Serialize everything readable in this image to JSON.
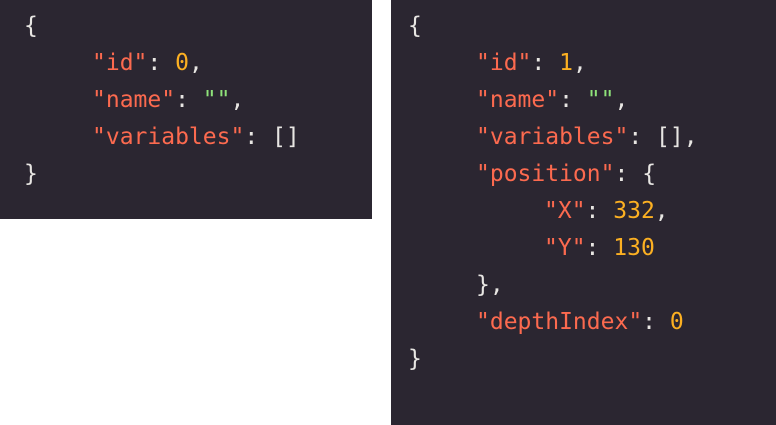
{
  "colors": {
    "background": "#2b2631",
    "key": "#fc6a4f",
    "number": "#fcb022",
    "string": "#8fe37a",
    "punctuation": "#e8e6e3"
  },
  "left": {
    "open_brace": "{",
    "id_key": "\"id\"",
    "id_value": "0",
    "name_key": "\"name\"",
    "name_value": "\"\"",
    "variables_key": "\"variables\"",
    "variables_value": "[]",
    "close_brace": "}"
  },
  "right": {
    "open_brace": "{",
    "id_key": "\"id\"",
    "id_value": "1",
    "name_key": "\"name\"",
    "name_value": "\"\"",
    "variables_key": "\"variables\"",
    "variables_value": "[]",
    "position_key": "\"position\"",
    "position_open": "{",
    "x_key": "\"X\"",
    "x_value": "332",
    "y_key": "\"Y\"",
    "y_value": "130",
    "position_close": "}",
    "depth_key": "\"depthIndex\"",
    "depth_value": "0",
    "close_brace": "}"
  }
}
